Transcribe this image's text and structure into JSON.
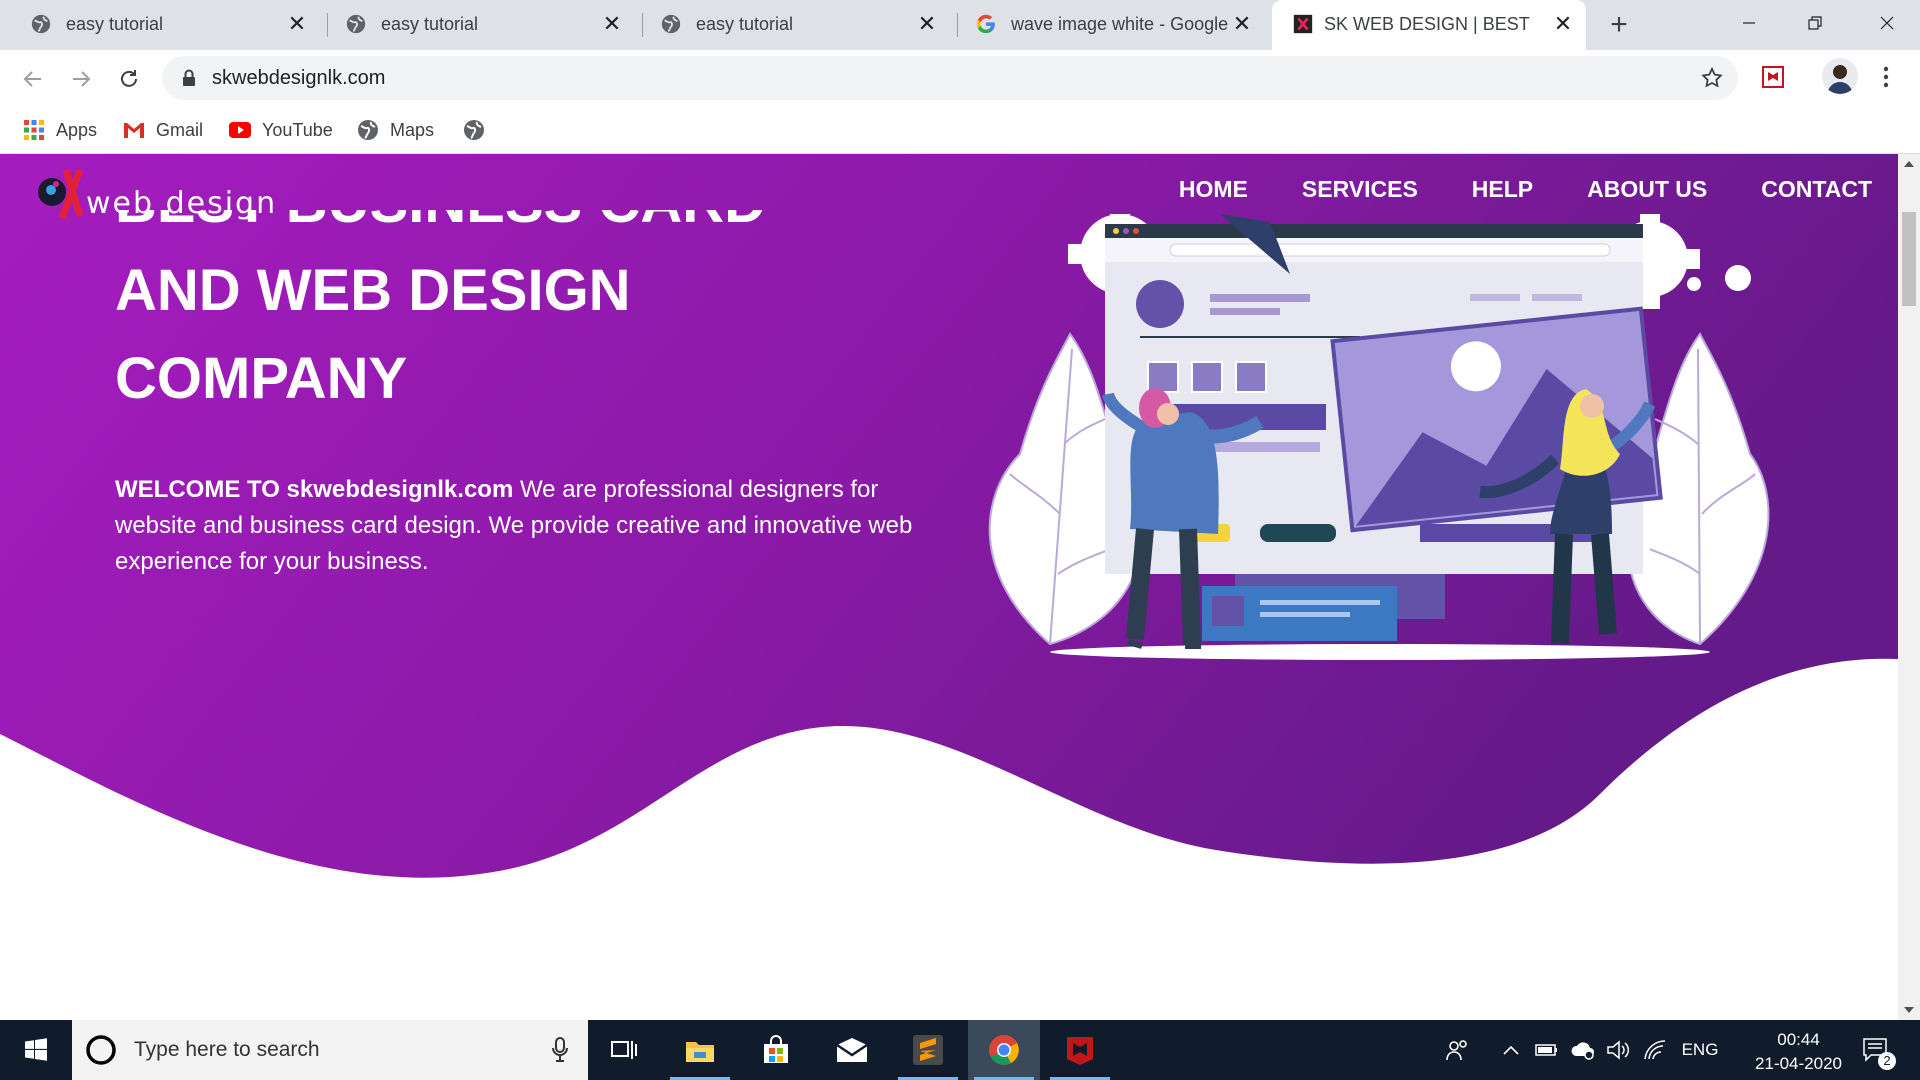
{
  "browser": {
    "tabs": [
      {
        "title": "easy tutorial",
        "icon": "globe-icon",
        "active": false
      },
      {
        "title": "easy tutorial",
        "icon": "globe-icon",
        "active": false
      },
      {
        "title": "easy tutorial",
        "icon": "globe-icon",
        "active": false
      },
      {
        "title": "wave image white - Google",
        "icon": "google-icon",
        "active": false
      },
      {
        "title": "SK WEB DESIGN | BEST WE",
        "icon": "sk-favicon",
        "active": true
      }
    ],
    "url": "skwebdesignlk.com",
    "bookmarks": [
      {
        "label": "Apps",
        "icon": "apps-icon"
      },
      {
        "label": "Gmail",
        "icon": "gmail-icon"
      },
      {
        "label": "YouTube",
        "icon": "youtube-icon"
      },
      {
        "label": "Maps",
        "icon": "globe-icon"
      },
      {
        "label": "",
        "icon": "globe-icon"
      }
    ]
  },
  "site": {
    "logo_text": "web design",
    "nav": [
      "HOME",
      "SERVICES",
      "HELP",
      "ABOUT US",
      "CONTACT"
    ],
    "heading_lines": [
      "BEST BUSINESS CARD",
      "AND WEB DESIGN",
      "COMPANY"
    ],
    "intro_bold": "WELCOME TO skwebdesignlk.com",
    "intro_text": " We are professional designers for website and business card design. We provide creative and innovative web experience for your business.",
    "colors": {
      "gradient_start": "#a11ab8",
      "gradient_end": "#6a1a8a",
      "accent": "#ff2d55"
    }
  },
  "taskbar": {
    "search_placeholder": "Type here to search",
    "language": "ENG",
    "time": "00:44",
    "date": "21-04-2020",
    "notification_count": "2"
  }
}
